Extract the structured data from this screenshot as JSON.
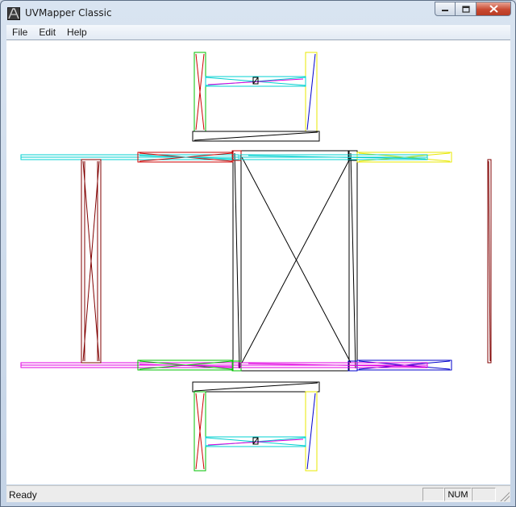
{
  "window": {
    "title": "UVMapper Classic",
    "controls": {
      "minimize": "▭",
      "maximize": "☐",
      "close": "✕"
    }
  },
  "menu": [
    "File",
    "Edit",
    "Help"
  ],
  "statusbar": {
    "text": "Ready",
    "panes": [
      "",
      "NUM",
      ""
    ]
  },
  "colors": {
    "edge_black": "#000000",
    "edge_red": "#cc0000",
    "edge_darkred": "#800000",
    "edge_green": "#00c000",
    "edge_yellow": "#e8e800",
    "edge_cyan": "#00d0d0",
    "edge_magenta": "#e000e0",
    "edge_blue": "#0000cc",
    "canvas_background": "#ffffff"
  },
  "icons": {
    "app": "uvmapper-app-icon",
    "minimize": "minimize-icon",
    "maximize": "maximize-icon",
    "close": "close-icon",
    "grip": "resize-grip-icon"
  }
}
